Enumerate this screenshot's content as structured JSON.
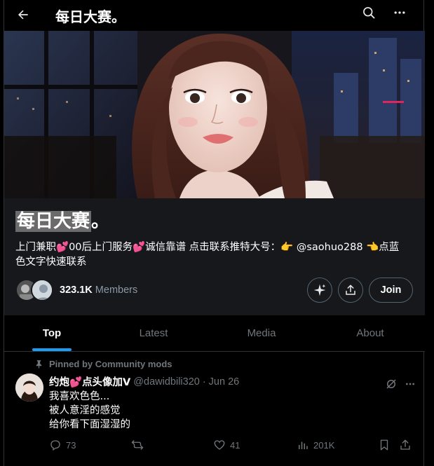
{
  "header": {
    "title": "每日大赛。",
    "back_icon": "arrow-left-icon",
    "search_icon": "search-icon",
    "more_icon": "more-horizontal-icon"
  },
  "community": {
    "name_highlight": "每日大赛",
    "name_suffix": "。",
    "description": {
      "line1_a": "上门兼职",
      "heart": "💕",
      "line1_b": "00后上门服务",
      "line1_c": "诚信靠谱 点击联系推特大号：",
      "hand_right": "👉",
      "handle": " @saohuo288 ",
      "hand_left": "👈",
      "line1_d": "点蓝",
      "line2": "色文字快速联系"
    },
    "member_count": "323.1K",
    "members_label": "Members",
    "join_label": "Join"
  },
  "tabs": [
    {
      "label": "Top",
      "active": true
    },
    {
      "label": "Latest",
      "active": false
    },
    {
      "label": "Media",
      "active": false
    },
    {
      "label": "About",
      "active": false
    }
  ],
  "post": {
    "pinned_label": "Pinned by Community mods",
    "author_name_a": "约炮",
    "author_heart": "💕",
    "author_name_b": "点头像加V",
    "handle": "@dawidbili320",
    "dot": "·",
    "date": "Jun 26",
    "lines": [
      "我喜欢色色...",
      "被人意淫的感觉",
      "给你看下面湿湿的"
    ],
    "replies": "73",
    "reposts": "",
    "likes": "41",
    "views": "201K"
  },
  "colors": {
    "accent": "#1d9bf0",
    "background": "#000000",
    "panel": "#16181c",
    "muted": "#71767b",
    "heart": "#e0245e"
  }
}
